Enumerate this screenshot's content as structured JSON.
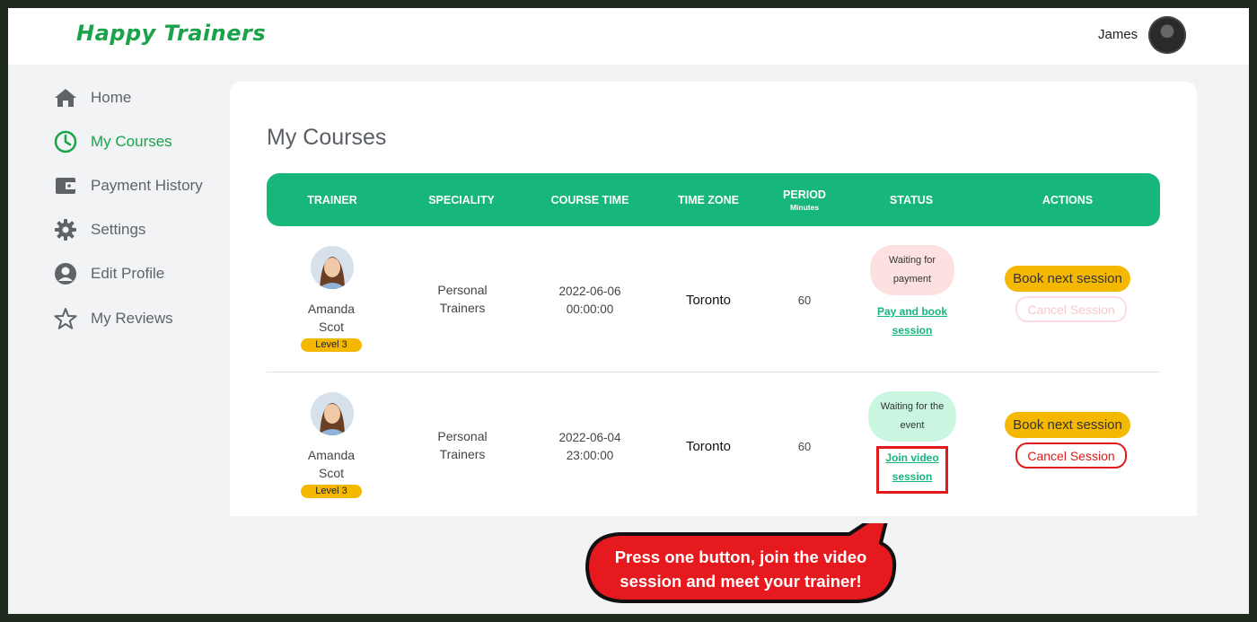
{
  "app": {
    "logo": "Happy Trainers",
    "user_name": "James"
  },
  "sidebar": {
    "items": [
      {
        "label": "Home",
        "icon": "home-icon",
        "active": false
      },
      {
        "label": "My Courses",
        "icon": "clock-icon",
        "active": true
      },
      {
        "label": "Payment History",
        "icon": "wallet-icon",
        "active": false
      },
      {
        "label": "Settings",
        "icon": "gear-icon",
        "active": false
      },
      {
        "label": "Edit Profile",
        "icon": "user-circle-icon",
        "active": false
      },
      {
        "label": "My Reviews",
        "icon": "star-outline-icon",
        "active": false
      }
    ]
  },
  "main": {
    "title": "My Courses",
    "columns": [
      {
        "label": "TRAINER"
      },
      {
        "label": "SPECIALITY"
      },
      {
        "label": "COURSE TIME"
      },
      {
        "label": "TIME ZONE"
      },
      {
        "label": "PERIOD",
        "sub": "Minutes"
      },
      {
        "label": "STATUS"
      },
      {
        "label": "ACTIONS"
      }
    ],
    "rows": [
      {
        "trainer_first": "Amanda",
        "trainer_last": "Scot",
        "level": "Level 3",
        "speciality_line1": "Personal",
        "speciality_line2": "Trainers",
        "date": "2022-06-06",
        "time": "00:00:00",
        "timezone": "Toronto",
        "period": "60",
        "status_line1": "Waiting for",
        "status_line2": "payment",
        "link_line1": "Pay and book",
        "link_line2": "session",
        "book_label": "Book next session",
        "cancel_label": "Cancel Session",
        "cancel_enabled": false
      },
      {
        "trainer_first": "Amanda",
        "trainer_last": "Scot",
        "level": "Level 3",
        "speciality_line1": "Personal",
        "speciality_line2": "Trainers",
        "date": "2022-06-04",
        "time": "23:00:00",
        "timezone": "Toronto",
        "period": "60",
        "status_line1": "Waiting for the",
        "status_line2": "event",
        "link_line1": "Join video",
        "link_line2": "session",
        "book_label": "Book next session",
        "cancel_label": "Cancel Session",
        "cancel_enabled": true
      }
    ]
  },
  "callout": {
    "line1": "Press one button, join the video",
    "line2": "session  and meet your trainer!"
  },
  "colors": {
    "brand_green": "#1aa34a",
    "table_header": "#17b67b",
    "button_yellow": "#f5b800",
    "cancel_red": "#e11b1b",
    "status_payment_bg": "#fde1e1",
    "status_event_bg": "#c9f5e1"
  }
}
